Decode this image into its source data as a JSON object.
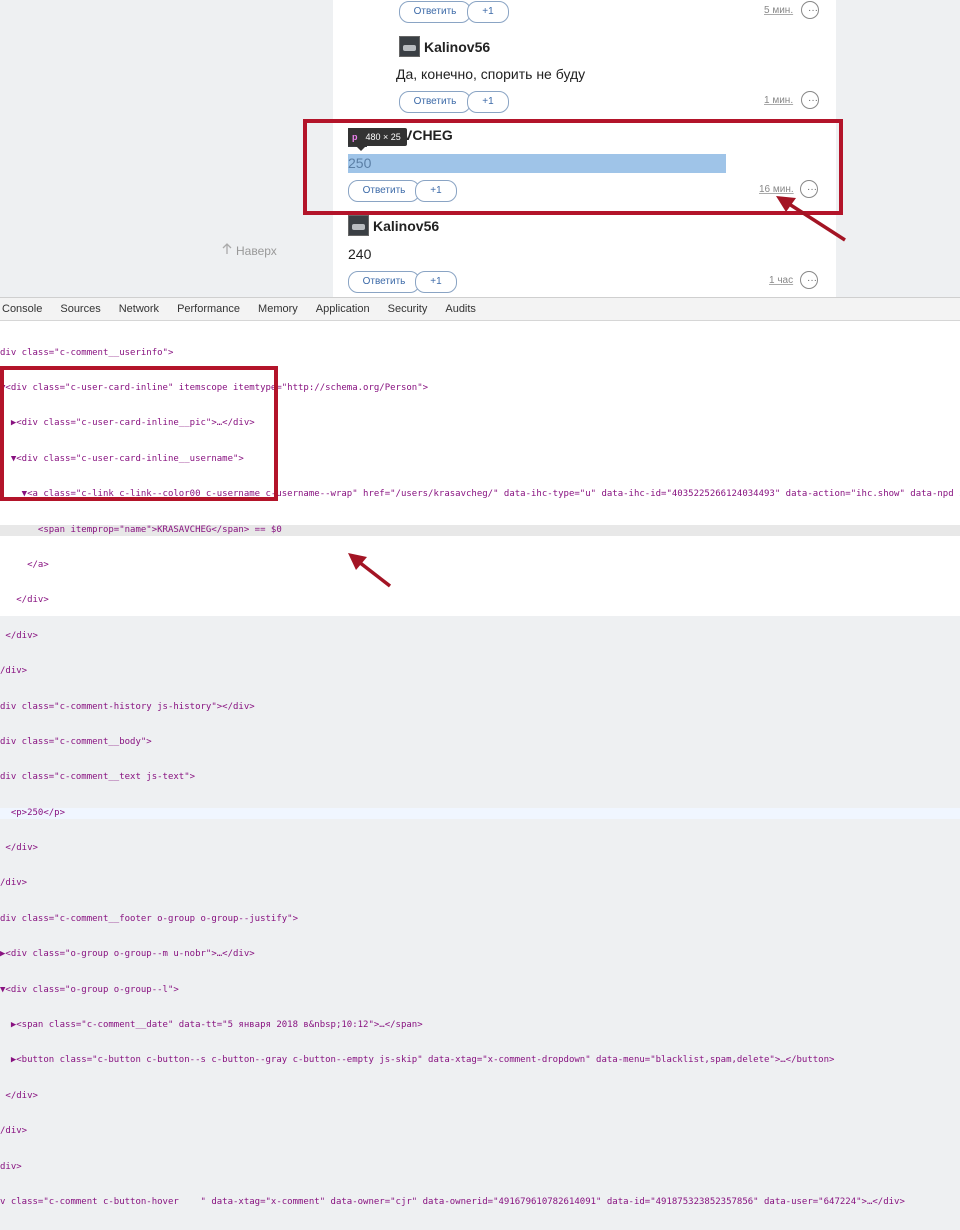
{
  "comments": [
    {
      "author": "",
      "text": "",
      "reply_label": "Ответить",
      "plus_label": "+1",
      "time": "5 мин.",
      "more_label": "···"
    },
    {
      "author": "Kalinov56",
      "text": "Да, конечно, спорить не буду",
      "reply_label": "Ответить",
      "plus_label": "+1",
      "time": "1 мин.",
      "more_label": "···"
    },
    {
      "author": "VCHEG",
      "text": "250",
      "reply_label": "Ответить",
      "plus_label": "+1",
      "time": "16 мин.",
      "more_label": "···"
    },
    {
      "author": "Kalinov56",
      "text": "240",
      "reply_label": "Ответить",
      "plus_label": "+1",
      "time": "1 час",
      "more_label": "···"
    }
  ],
  "inspect_tooltip": {
    "tag": "p",
    "size": "480 × 25"
  },
  "back_to_top": {
    "label": "Наверх",
    "icon": "arrow-up-icon"
  },
  "devtools": {
    "tabs": [
      "Console",
      "Sources",
      "Network",
      "Performance",
      "Memory",
      "Application",
      "Security",
      "Audits"
    ],
    "dom_lines": [
      "div class=\"c-comment__userinfo\">",
      "▼<div class=\"c-user-card-inline\" itemscope itemtype=\"http://schema.org/Person\">",
      "  ▶<div class=\"c-user-card-inline__pic\">…</div>",
      "  ▼<div class=\"c-user-card-inline__username\">",
      "    ▼<a class=\"c-link c-link--color00 c-username c-username--wrap\" href=\"/users/krasavcheg/\" data-ihc-type=\"u\" data-ihc-id=\"4035225266124034493\" data-action=\"ihc.show\" data-npd itemprop",
      "       <span itemprop=\"name\">KRASAVCHEG</span> == $0",
      "     </a>",
      "   </div>",
      " </div>",
      "/div>",
      "div class=\"c-comment-history js-history\"></div>",
      "div class=\"c-comment__body\">",
      "div class=\"c-comment__text js-text\">",
      "  <p>250</p>",
      " </div>",
      "/div>",
      "div class=\"c-comment__footer o-group o-group--justify\">",
      "▶<div class=\"o-group o-group--m u-nobr\">…</div>",
      "▼<div class=\"o-group o-group--l\">",
      "  ▶<span class=\"c-comment__date\" data-tt=\"5 января 2018 в&nbsp;10:12\">…</span>",
      "  ▶<button class=\"c-button c-button--s c-button--gray c-button--empty js-skip\" data-xtag=\"x-comment-dropdown\" data-menu=\"blacklist,spam,delete\">…</button>",
      " </div>",
      "/div>",
      "div>",
      "v class=\"c-comment c-button-hover    \" data-xtag=\"x-comment\" data-owner=\"cjr\" data-ownerid=\"491679610782614091\" data-id=\"491875323852357856\" data-user=\"647224\">…</div>"
    ]
  },
  "colors": {
    "highlight_box": "#b3142a",
    "arrow": "#a31424",
    "inspect_fill": "#9fc4e8",
    "link_blue": "#3c6aa8"
  }
}
